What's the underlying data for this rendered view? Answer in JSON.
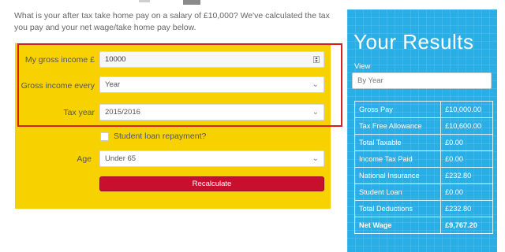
{
  "intro_text": "What is your after tax take home pay on a salary of £10,000? We've calculated the tax you pay and your net wage/take home pay below.",
  "form": {
    "gross_income_label": "My gross income £",
    "gross_income_value": "10000",
    "gross_every_label": "Gross income every",
    "gross_every_value": "Year",
    "tax_year_label": "Tax year",
    "tax_year_value": "2015/2016",
    "student_loan_label": "Student loan repayment?",
    "age_label": "Age",
    "age_value": "Under 65",
    "recalculate_label": "Recalculate"
  },
  "results": {
    "title": "Your Results",
    "view_label": "View",
    "view_value": "By Year",
    "rows": [
      {
        "label": "Gross Pay",
        "value": "£10,000.00"
      },
      {
        "label": "Tax Free Allowance",
        "value": "£10,600.00"
      },
      {
        "label": "Total Taxable",
        "value": "£0.00"
      },
      {
        "label": "Income Tax Paid",
        "value": "£0.00"
      },
      {
        "label": "National Insurance",
        "value": "£232.80"
      },
      {
        "label": "Student Loan",
        "value": "£0.00"
      },
      {
        "label": "Total Deductions",
        "value": "£232.80"
      },
      {
        "label": "Net Wage",
        "value": "£9,767.20"
      }
    ]
  },
  "colors": {
    "form_panel": "#f7d200",
    "results_panel": "#29aee6",
    "recalculate_button": "#c8102e",
    "highlight_box": "#d92020"
  },
  "icons": {
    "select_chevron": "chevron-down-icon",
    "number_spinner": "spinner-icon"
  }
}
